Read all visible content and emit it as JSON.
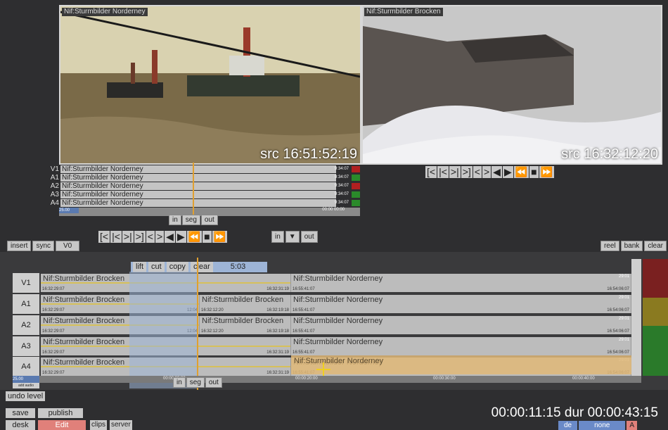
{
  "viewers": {
    "source": {
      "title": "Nif:Sturmbilder Norderney",
      "timecode": "src 16:51:52:19"
    },
    "record": {
      "title": "Nif:Sturmbilder Brocken",
      "timecode": "src 16:32:12:20"
    }
  },
  "transport": {
    "prev_mark": "[<",
    "prev": "|<",
    "next": ">|",
    "next_mark": ">]",
    "step_back": "<",
    "step_fwd": ">",
    "play_back": "◀",
    "play": "▶",
    "rewind": "⏪",
    "stop": "■",
    "fast_fwd": "⏩"
  },
  "source_tracks": [
    {
      "label": "V1",
      "clip": "Nif:Sturmbilder Norderney",
      "dur": "9:34:07",
      "flag": "#b02020"
    },
    {
      "label": "A1",
      "clip": "Nif:Sturmbilder Norderney",
      "dur": "9:34:07",
      "flag": "#2a8a2a"
    },
    {
      "label": "A2",
      "clip": "Nif:Sturmbilder Norderney",
      "dur": "9:34:07",
      "flag": "#b02020"
    },
    {
      "label": "A3",
      "clip": "Nif:Sturmbilder Norderney",
      "dur": "9:34:07",
      "flag": "#2a8a2a"
    },
    {
      "label": "A4",
      "clip": "Nif:Sturmbilder Norderney",
      "dur": "9:34:07",
      "flag": "#2a8a2a"
    }
  ],
  "source_ruler": {
    "fps": "25.00",
    "time": "00:00 00:00"
  },
  "mark_buttons": {
    "in": "in",
    "seg": "seg",
    "out": "out",
    "down": "▼"
  },
  "toolbar_left": {
    "insert": "insert",
    "sync": "sync",
    "v0": "V0"
  },
  "toolbar_right": {
    "reel": "reel",
    "bank": "bank",
    "clear": "clear"
  },
  "edit_ops": {
    "lift": "lift",
    "cut": "cut",
    "copy": "copy",
    "clear": "clear",
    "duration": "5:03"
  },
  "timeline": {
    "tracks": [
      {
        "label": "V1",
        "clip_a": "Nif:Sturmbilder Brocken",
        "clip_a2": "Nif:Sturmbilder Brocken",
        "clip_b": "Nif:Sturmbilder Norderney",
        "tc_a_in": "16:32:29:07",
        "tc_a_out": "16:32:31:19",
        "tc_mid": "16:32:19:18",
        "tc_b_in": "16:55:41:07",
        "tc_b_out": "16:54:06:07",
        "dur_a": "12:04",
        "dur_b": "29:01"
      },
      {
        "label": "A1",
        "clip_a": "Nif:Sturmbilder Brocken",
        "clip_a2": "Nif:Sturmbilder Brocken",
        "clip_b": "Nif:Sturmbilder Norderney",
        "tc_a_in": "16:32:29:07",
        "tc_a_out": "16:32:12:20",
        "tc_mid": "16:32:19:18",
        "tc_b_in": "16:55:41:07",
        "tc_b_out": "16:54:06:07",
        "dur_a": "12:04",
        "dur_b": "29:01"
      },
      {
        "label": "A2",
        "clip_a": "Nif:Sturmbilder Brocken",
        "clip_a2": "Nif:Sturmbilder Brocken",
        "clip_b": "Nif:Sturmbilder Norderney",
        "tc_a_in": "16:32:29:07",
        "tc_a_out": "16:32:12:20",
        "tc_mid": "16:32:19:18",
        "tc_b_in": "16:55:41:07",
        "tc_b_out": "16:54:06:07",
        "dur_a": "12:04",
        "dur_b": "29:01"
      },
      {
        "label": "A3",
        "clip_a": "Nif:Sturmbilder Brocken",
        "clip_a2": "Nif:Sturmbilder Brocken",
        "clip_b": "Nif:Sturmbilder Norderney",
        "tc_a_in": "16:32:29:07",
        "tc_a_out": "16:32:31:19",
        "tc_mid": "16:32:19:18",
        "tc_b_in": "16:55:41:07",
        "tc_b_out": "16:54:06:07",
        "dur_a": "12:04",
        "dur_b": "29:01"
      },
      {
        "label": "A4",
        "clip_a": "Nif:Sturmbilder Brocken",
        "clip_a2": "Nif:Sturmbilder Brocken",
        "clip_b": "Nif:Sturmbilder Norderney",
        "tc_a_in": "16:32:29:07",
        "tc_a_out": "16:32:31:19",
        "tc_mid": "16:32:19:18",
        "tc_b_in": "16:55:41:07",
        "tc_b_out": "16:54:06:07",
        "dur_a": "12:04",
        "dur_b": "29:01"
      }
    ],
    "ruler": {
      "fps": "25.00",
      "t0": "00:00:00:00",
      "t1": "00:00:20:00",
      "t2": "00:00:30:00",
      "t3": "00:00:40:00"
    },
    "add_audio": "add audio",
    "side_colors": [
      "#7a2020",
      "#8a7a20",
      "#2a8a2a",
      "#2a8a2a",
      "#2a8a2a"
    ]
  },
  "bottom": {
    "undo_level": "undo level",
    "save": "save",
    "publish": "publish",
    "desk": "desk",
    "edit": "Edit",
    "clips": "clips",
    "server": "server",
    "position": "00:00:11:15",
    "dur_label": "dur",
    "duration": "00:00:43:15",
    "de": "de",
    "none": "none",
    "a": "A"
  },
  "colors": {
    "edit_tab": "#e0807a",
    "selection": "#9db4d6",
    "playhead": "#e0a030",
    "highlight": "#e0b878"
  }
}
